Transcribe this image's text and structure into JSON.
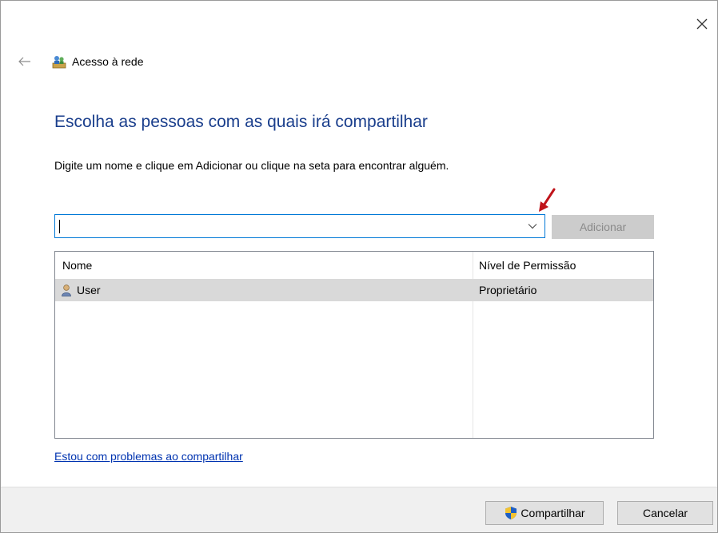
{
  "nav": {
    "title": "Acesso à rede"
  },
  "heading": "Escolha as pessoas com as quais irá compartilhar",
  "instruction": "Digite um nome e clique em Adicionar ou clique na seta para encontrar alguém.",
  "name_input": {
    "value": "",
    "placeholder": ""
  },
  "buttons": {
    "add": "Adicionar",
    "share": "Compartilhar",
    "cancel": "Cancelar"
  },
  "table": {
    "columns": [
      "Nome",
      "Nível de Permissão"
    ],
    "rows": [
      {
        "name": "User",
        "permission": "Proprietário",
        "icon": "user-icon"
      }
    ]
  },
  "help_link": "Estou com problemas ao compartilhar",
  "colors": {
    "heading": "#1a3e8c",
    "focus_border": "#0078d7",
    "link": "#0033b0",
    "annotation_arrow": "#c0141b"
  }
}
